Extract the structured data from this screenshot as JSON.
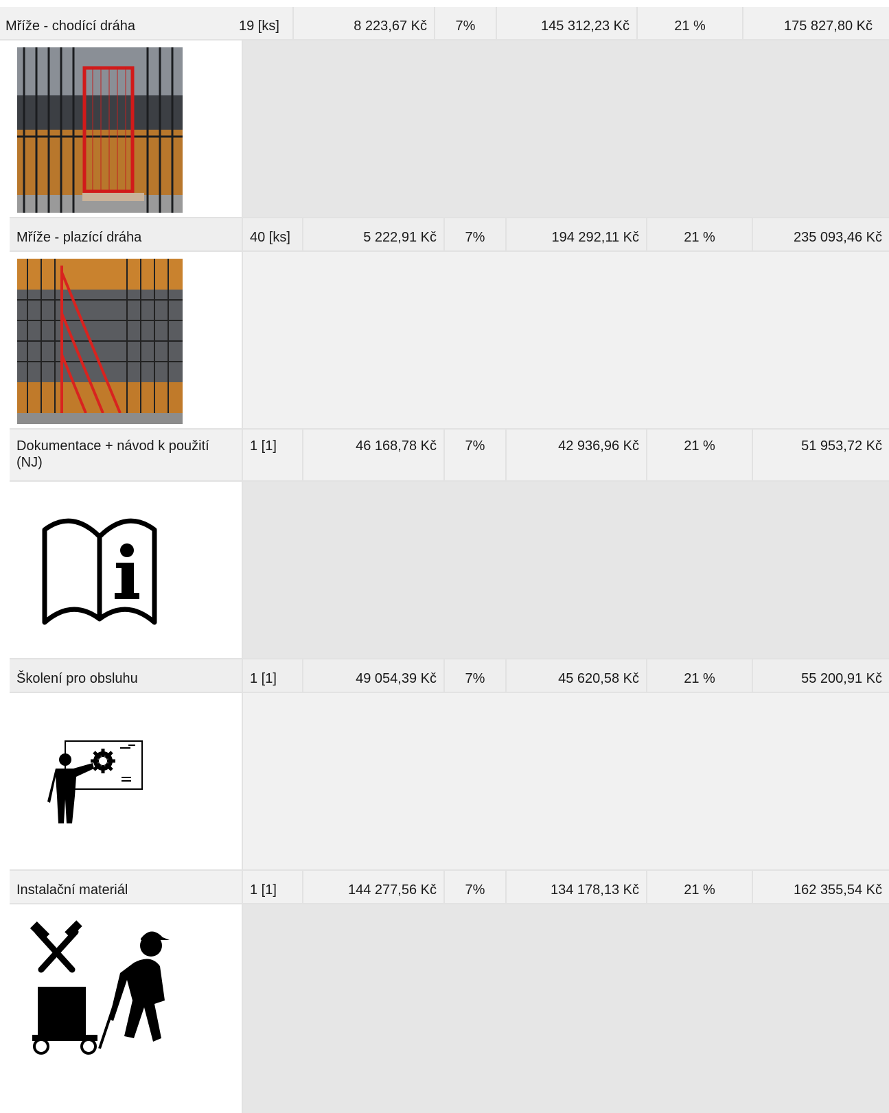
{
  "rows": [
    {
      "name": "Mříže - chodící dráha",
      "qty": "19 [ks]",
      "unit_price": "8 223,67 Kč",
      "discount": "7%",
      "net_total": "145 312,23 Kč",
      "vat_rate": "21 %",
      "gross_total": "175 827,80 Kč",
      "image": "walking-track-cage-photo"
    },
    {
      "name": "Mříže - plazící dráha",
      "qty": "40 [ks]",
      "unit_price": "5 222,91 Kč",
      "discount": "7%",
      "net_total": "194 292,11 Kč",
      "vat_rate": "21 %",
      "gross_total": "235 093,46 Kč",
      "image": "crawling-track-cage-photo"
    },
    {
      "name": "Dokumentace + návod k použití (NJ)",
      "qty": "1 [1]",
      "unit_price": "46 168,78 Kč",
      "discount": "7%",
      "net_total": "42 936,96 Kč",
      "vat_rate": "21 %",
      "gross_total": "51 953,72 Kč",
      "image": "manual-info-icon"
    },
    {
      "name": "Školení pro obsluhu",
      "qty": "1 [1]",
      "unit_price": "49 054,39 Kč",
      "discount": "7%",
      "net_total": "45 620,58 Kč",
      "vat_rate": "21 %",
      "gross_total": "55 200,91 Kč",
      "image": "training-presenter-icon"
    },
    {
      "name": "Instalační materiál",
      "qty": "1 [1]",
      "unit_price": "144 277,56 Kč",
      "discount": "7%",
      "net_total": "134 178,13 Kč",
      "vat_rate": "21 %",
      "gross_total": "162 355,54 Kč",
      "image": "installation-worker-icon"
    }
  ]
}
